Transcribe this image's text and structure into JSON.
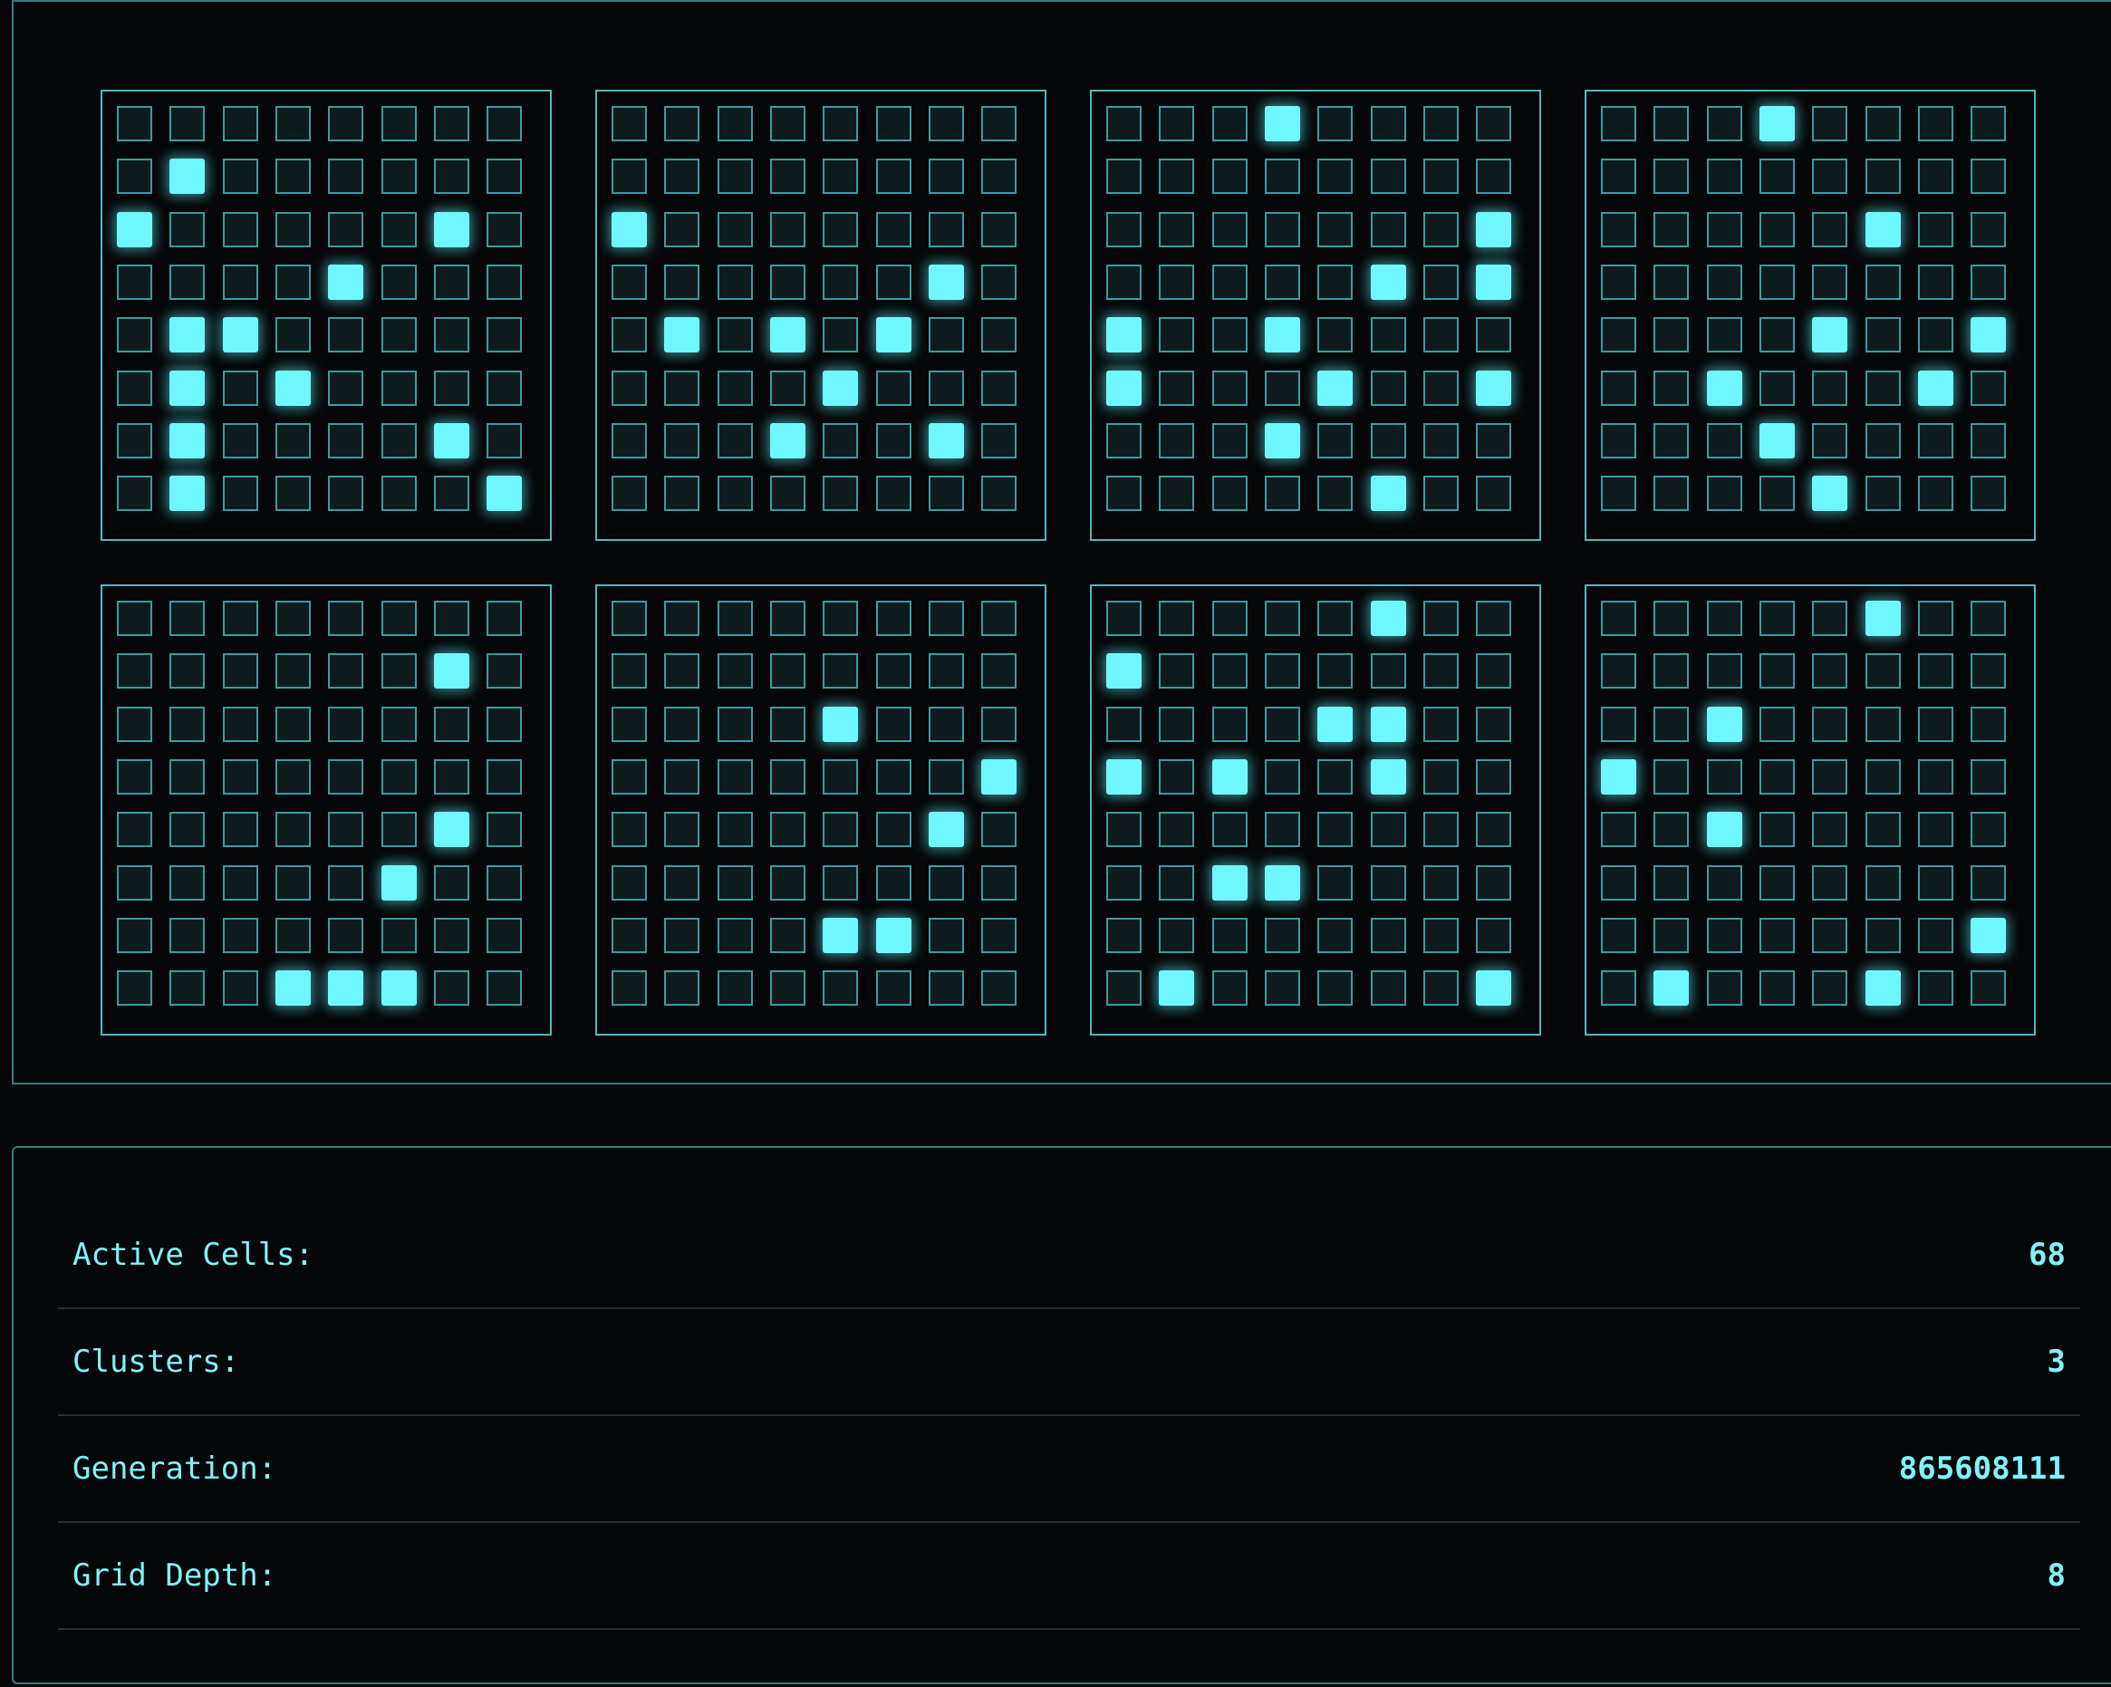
{
  "grids": [
    [
      [
        0,
        0,
        0,
        0,
        0,
        0,
        0,
        0
      ],
      [
        0,
        1,
        0,
        0,
        0,
        0,
        0,
        0
      ],
      [
        1,
        0,
        0,
        0,
        0,
        0,
        1,
        0
      ],
      [
        0,
        0,
        0,
        0,
        1,
        0,
        0,
        0
      ],
      [
        0,
        1,
        1,
        0,
        0,
        0,
        0,
        0
      ],
      [
        0,
        1,
        0,
        1,
        0,
        0,
        0,
        0
      ],
      [
        0,
        1,
        0,
        0,
        0,
        0,
        1,
        0
      ],
      [
        0,
        1,
        0,
        0,
        0,
        0,
        0,
        1
      ]
    ],
    [
      [
        0,
        0,
        0,
        0,
        0,
        0,
        0,
        0
      ],
      [
        0,
        0,
        0,
        0,
        0,
        0,
        0,
        0
      ],
      [
        1,
        0,
        0,
        0,
        0,
        0,
        0,
        0
      ],
      [
        0,
        0,
        0,
        0,
        0,
        0,
        1,
        0
      ],
      [
        0,
        1,
        0,
        1,
        0,
        1,
        0,
        0
      ],
      [
        0,
        0,
        0,
        0,
        1,
        0,
        0,
        0
      ],
      [
        0,
        0,
        0,
        1,
        0,
        0,
        1,
        0
      ],
      [
        0,
        0,
        0,
        0,
        0,
        0,
        0,
        0
      ]
    ],
    [
      [
        0,
        0,
        0,
        1,
        0,
        0,
        0,
        0
      ],
      [
        0,
        0,
        0,
        0,
        0,
        0,
        0,
        0
      ],
      [
        0,
        0,
        0,
        0,
        0,
        0,
        0,
        1
      ],
      [
        0,
        0,
        0,
        0,
        0,
        1,
        0,
        1
      ],
      [
        1,
        0,
        0,
        1,
        0,
        0,
        0,
        0
      ],
      [
        1,
        0,
        0,
        0,
        1,
        0,
        0,
        1
      ],
      [
        0,
        0,
        0,
        1,
        0,
        0,
        0,
        0
      ],
      [
        0,
        0,
        0,
        0,
        0,
        1,
        0,
        0
      ]
    ],
    [
      [
        0,
        0,
        0,
        1,
        0,
        0,
        0,
        0
      ],
      [
        0,
        0,
        0,
        0,
        0,
        0,
        0,
        0
      ],
      [
        0,
        0,
        0,
        0,
        0,
        1,
        0,
        0
      ],
      [
        0,
        0,
        0,
        0,
        0,
        0,
        0,
        0
      ],
      [
        0,
        0,
        0,
        0,
        1,
        0,
        0,
        1
      ],
      [
        0,
        0,
        1,
        0,
        0,
        0,
        1,
        0
      ],
      [
        0,
        0,
        0,
        1,
        0,
        0,
        0,
        0
      ],
      [
        0,
        0,
        0,
        0,
        1,
        0,
        0,
        0
      ]
    ],
    [
      [
        0,
        0,
        0,
        0,
        0,
        0,
        0,
        0
      ],
      [
        0,
        0,
        0,
        0,
        0,
        0,
        1,
        0
      ],
      [
        0,
        0,
        0,
        0,
        0,
        0,
        0,
        0
      ],
      [
        0,
        0,
        0,
        0,
        0,
        0,
        0,
        0
      ],
      [
        0,
        0,
        0,
        0,
        0,
        0,
        1,
        0
      ],
      [
        0,
        0,
        0,
        0,
        0,
        1,
        0,
        0
      ],
      [
        0,
        0,
        0,
        0,
        0,
        0,
        0,
        0
      ],
      [
        0,
        0,
        0,
        1,
        1,
        1,
        0,
        0
      ]
    ],
    [
      [
        0,
        0,
        0,
        0,
        0,
        0,
        0,
        0
      ],
      [
        0,
        0,
        0,
        0,
        0,
        0,
        0,
        0
      ],
      [
        0,
        0,
        0,
        0,
        1,
        0,
        0,
        0
      ],
      [
        0,
        0,
        0,
        0,
        0,
        0,
        0,
        1
      ],
      [
        0,
        0,
        0,
        0,
        0,
        0,
        1,
        0
      ],
      [
        0,
        0,
        0,
        0,
        0,
        0,
        0,
        0
      ],
      [
        0,
        0,
        0,
        0,
        1,
        1,
        0,
        0
      ],
      [
        0,
        0,
        0,
        0,
        0,
        0,
        0,
        0
      ]
    ],
    [
      [
        0,
        0,
        0,
        0,
        0,
        1,
        0,
        0
      ],
      [
        1,
        0,
        0,
        0,
        0,
        0,
        0,
        0
      ],
      [
        0,
        0,
        0,
        0,
        1,
        1,
        0,
        0
      ],
      [
        1,
        0,
        1,
        0,
        0,
        1,
        0,
        0
      ],
      [
        0,
        0,
        0,
        0,
        0,
        0,
        0,
        0
      ],
      [
        0,
        0,
        1,
        1,
        0,
        0,
        0,
        0
      ],
      [
        0,
        0,
        0,
        0,
        0,
        0,
        0,
        0
      ],
      [
        0,
        1,
        0,
        0,
        0,
        0,
        0,
        1
      ]
    ],
    [
      [
        0,
        0,
        0,
        0,
        0,
        1,
        0,
        0
      ],
      [
        0,
        0,
        0,
        0,
        0,
        0,
        0,
        0
      ],
      [
        0,
        0,
        1,
        0,
        0,
        0,
        0,
        0
      ],
      [
        1,
        0,
        0,
        0,
        0,
        0,
        0,
        0
      ],
      [
        0,
        0,
        1,
        0,
        0,
        0,
        0,
        0
      ],
      [
        0,
        0,
        0,
        0,
        0,
        0,
        0,
        0
      ],
      [
        0,
        0,
        0,
        0,
        0,
        0,
        0,
        1
      ],
      [
        0,
        1,
        0,
        0,
        0,
        1,
        0,
        0
      ]
    ]
  ],
  "stats": [
    {
      "label": "Active Cells:",
      "value": "68"
    },
    {
      "label": "Clusters:",
      "value": "3"
    },
    {
      "label": "Generation:",
      "value": "865608111"
    },
    {
      "label": "Grid Depth:",
      "value": "8"
    }
  ],
  "colors": {
    "cell_on": "#6ff7ff",
    "cell_off": "#0d1b1d",
    "border": "#4fb8c0",
    "text": "#7ff3fb"
  }
}
